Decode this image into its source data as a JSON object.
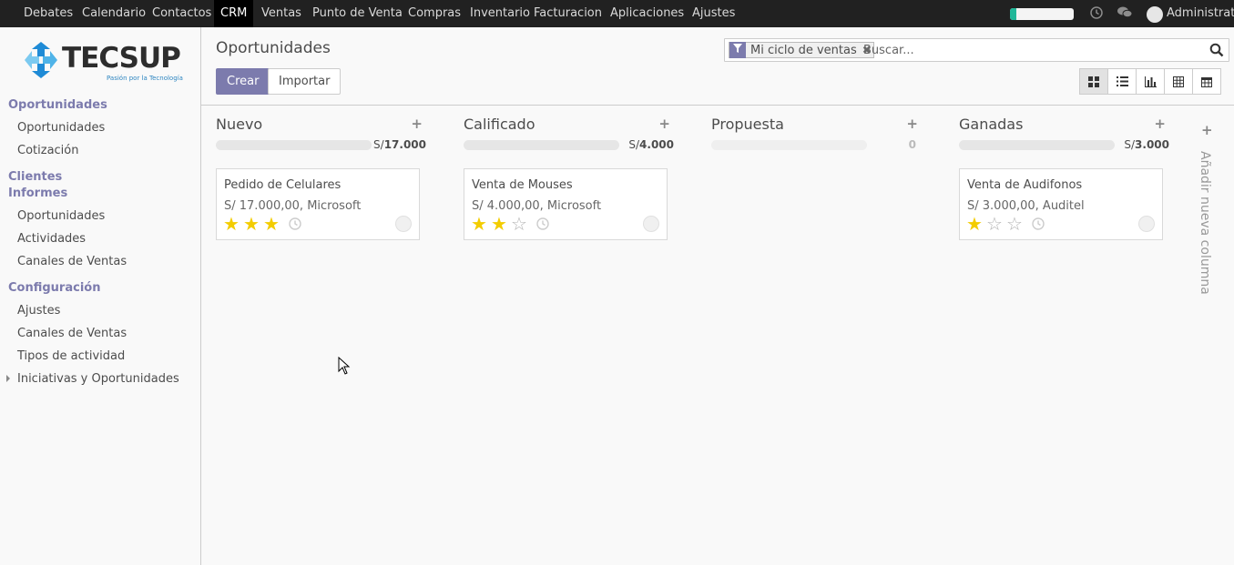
{
  "topbar": {
    "menu": [
      "Debates",
      "Calendario",
      "Contactos",
      "CRM",
      "Ventas",
      "Punto de Venta",
      "Compras",
      "Inventario",
      "Facturacion",
      "Aplicaciones",
      "Ajustes"
    ],
    "active": "CRM",
    "user": "Administrato",
    "icons": [
      "clock-icon",
      "chat-icon"
    ],
    "battery_level": 0.1
  },
  "sidebar": {
    "logo": {
      "name": "TECSUP",
      "tagline": "Pasión por la Tecnología"
    },
    "sections": [
      {
        "title": "Oportunidades",
        "items": [
          "Oportunidades",
          "Cotización"
        ]
      },
      {
        "title": "Clientes",
        "items": []
      },
      {
        "title": "Informes",
        "items": [
          "Oportunidades",
          "Actividades",
          "Canales de Ventas"
        ]
      },
      {
        "title": "Configuración",
        "items": [
          "Ajustes",
          "Canales de Ventas",
          "Tipos de actividad",
          "Iniciativas y Oportunidades"
        ]
      }
    ]
  },
  "control": {
    "title": "Oportunidades",
    "create_label": "Crear",
    "import_label": "Importar",
    "facet_label": "Mi ciclo de ventas",
    "search_placeholder": "Buscar...",
    "views": [
      "kanban-icon",
      "list-icon",
      "graph-icon",
      "pivot-icon",
      "calendar-icon"
    ],
    "active_view": "kanban-icon"
  },
  "kanban": {
    "columns": [
      {
        "title": "Nuevo",
        "currency": "S/",
        "total": "17.000",
        "cards": [
          {
            "name": "Pedido de Celulares",
            "amount": "S/ 17.000,00, Microsoft",
            "stars": 3
          }
        ]
      },
      {
        "title": "Calificado",
        "currency": "S/",
        "total": "4.000",
        "cards": [
          {
            "name": "Venta de Mouses",
            "amount": "S/ 4.000,00, Microsoft",
            "stars": 2
          }
        ]
      },
      {
        "title": "Propuesta",
        "currency": "",
        "total": "0",
        "cards": []
      },
      {
        "title": "Ganadas",
        "currency": "S/",
        "total": "3.000",
        "cards": [
          {
            "name": "Venta de Audifonos",
            "amount": "S/ 3.000,00, Auditel",
            "stars": 1
          }
        ]
      }
    ],
    "add_column_label": "Añadir nueva columna"
  },
  "colors": {
    "accent": "#7c7bad",
    "star": "#f3cc00",
    "topbar": "#212121"
  }
}
